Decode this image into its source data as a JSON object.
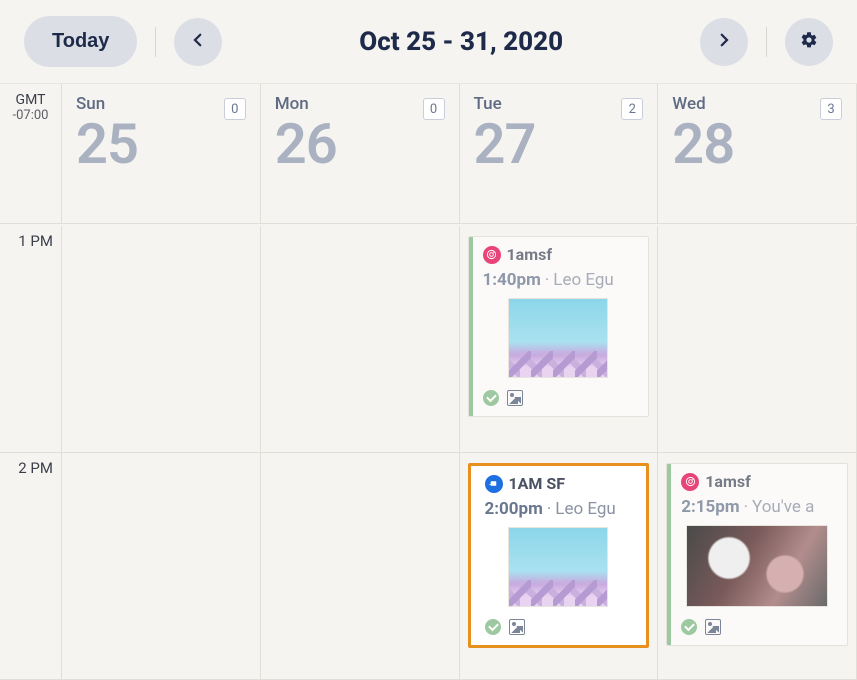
{
  "toolbar": {
    "today_label": "Today",
    "range_title": "Oct 25 - 31, 2020"
  },
  "timezone": {
    "label": "GMT",
    "offset": "-07:00"
  },
  "days": [
    {
      "abbr": "Sun",
      "num": "25",
      "count": "0"
    },
    {
      "abbr": "Mon",
      "num": "26",
      "count": "0"
    },
    {
      "abbr": "Tue",
      "num": "27",
      "count": "2"
    },
    {
      "abbr": "Wed",
      "num": "28",
      "count": "3"
    }
  ],
  "hours": {
    "h1": "1 PM",
    "h2": "2 PM"
  },
  "events": {
    "tue_1pm": {
      "network": "instagram",
      "account": "1amsf",
      "time": "1:40pm",
      "text": "Leo Egu"
    },
    "tue_2pm": {
      "network": "facebook",
      "account": "1AM SF",
      "time": "2:00pm",
      "text": "Leo Egu"
    },
    "wed_2pm": {
      "network": "instagram",
      "account": "1amsf",
      "time": "2:15pm",
      "text": "You've a"
    }
  },
  "icons": {
    "prev": "chevron-left",
    "next": "chevron-right",
    "settings": "gear",
    "status_ok": "check",
    "media": "image"
  },
  "colors": {
    "accent_highlight": "#e8901e",
    "status_ok": "#9dc8a0",
    "instagram": "#e8447a",
    "facebook": "#1e6fe0"
  }
}
